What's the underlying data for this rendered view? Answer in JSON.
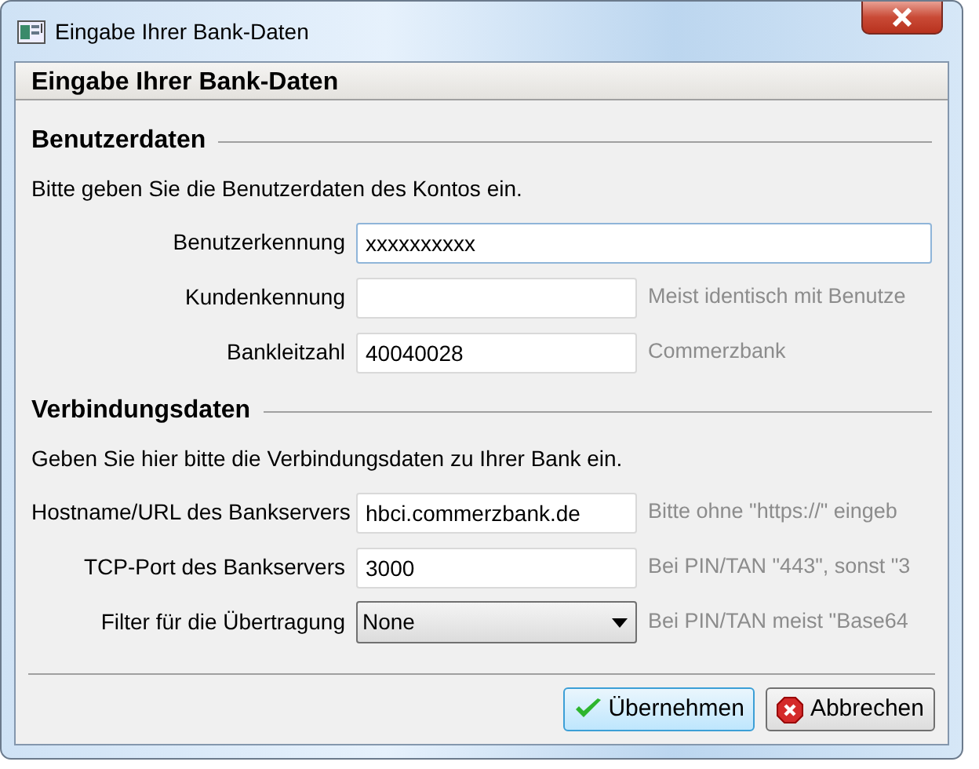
{
  "window": {
    "title": "Eingabe Ihrer Bank-Daten"
  },
  "header": "Eingabe Ihrer Bank-Daten",
  "sections": [
    {
      "title": "Benutzerdaten",
      "intro": "Bitte geben Sie die Benutzerdaten des Kontos ein.",
      "fields": [
        {
          "kind": "text",
          "label": "Benutzerkennung",
          "value": "xxxxxxxxxx",
          "focused": true
        },
        {
          "kind": "text",
          "label": "Kundenkennung",
          "focused": false,
          "hint": "Meist identisch mit Benutze"
        },
        {
          "kind": "text",
          "label": "Bankleitzahl",
          "value": "40040028",
          "focused": false,
          "hint": "Commerzbank"
        }
      ]
    },
    {
      "title": "Verbindungsdaten",
      "intro": "Geben Sie hier bitte die Verbindungsdaten zu Ihrer Bank ein.",
      "fields": [
        {
          "kind": "text",
          "label": "Hostname/URL des Bankservers",
          "value": "hbci.commerzbank.de",
          "focused": false,
          "hint": "Bitte ohne \"https://\" eingeb"
        },
        {
          "kind": "text",
          "label": "TCP-Port des Bankservers",
          "value": "3000",
          "focused": false,
          "hint": "Bei PIN/TAN \"443\", sonst \"3"
        },
        {
          "kind": "select",
          "label": "Filter für die Übertragung",
          "value": "None",
          "focused": false,
          "hint": "Bei PIN/TAN meist \"Base64"
        }
      ]
    }
  ],
  "buttons": [
    {
      "kind": "ok",
      "label": "Übernehmen",
      "default": true
    },
    {
      "kind": "cancel",
      "label": "Abbrechen",
      "default": false
    }
  ]
}
